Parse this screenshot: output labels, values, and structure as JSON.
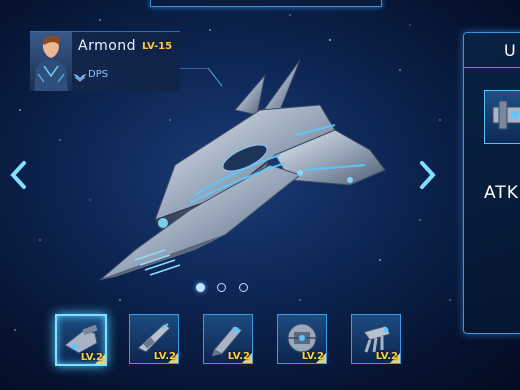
{
  "pilot": {
    "name": "Armond",
    "level": "LV-15",
    "role": "DPS"
  },
  "carousel": {
    "dot_count": 3,
    "active_dot": 0
  },
  "right_panel": {
    "title": "U",
    "stat_label": "ATK"
  },
  "equipment_slots": [
    {
      "level": "LV.2",
      "icon": "cannon-icon",
      "selected": true
    },
    {
      "level": "LV.2",
      "icon": "laser-gun-icon",
      "selected": false
    },
    {
      "level": "LV.2",
      "icon": "missile-pod-icon",
      "selected": false
    },
    {
      "level": "LV.2",
      "icon": "shield-module-icon",
      "selected": false
    },
    {
      "level": "LV.2",
      "icon": "drone-icon",
      "selected": false
    }
  ],
  "colors": {
    "accent": "#3b98e0",
    "level_gold": "#ffd23a",
    "highlight": "#7fe0ff"
  }
}
